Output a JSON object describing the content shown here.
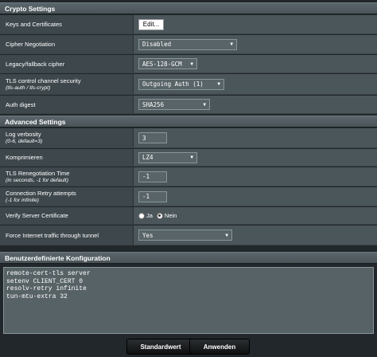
{
  "crypto": {
    "header": "Crypto Settings",
    "keys_label": "Keys and Certificates",
    "edit_label": "Edit...",
    "cipher_neg_label": "Cipher Negotiation",
    "cipher_neg_value": "Disabled",
    "legacy_label": "Legacy/fallback cipher",
    "legacy_value": "AES-128-GCM",
    "tls_label": "TLS control channel security",
    "tls_sub": "(tls-auth / tls-crypt)",
    "tls_value": "Outgoing Auth (1)",
    "digest_label": "Auth digest",
    "digest_value": "SHA256"
  },
  "advanced": {
    "header": "Advanced Settings",
    "log_label": "Log verbosity",
    "log_sub": "(0-6, default=3)",
    "log_value": "3",
    "comp_label": "Komprimieren",
    "comp_value": "LZ4",
    "reneg_label": "TLS Renegotiation Time",
    "reneg_sub": "(in seconds, -1 for default)",
    "reneg_value": "-1",
    "retry_label": "Connection Retry attempts",
    "retry_sub": "(-1 for infinite)",
    "retry_value": "-1",
    "verify_label": "Verify Server Certificate",
    "verify_yes": "Ja",
    "verify_no": "Nein",
    "force_label": "Force Internet traffic through tunnel",
    "force_value": "Yes"
  },
  "custom": {
    "header": "Benutzerdefinierte Konfiguration",
    "text": "remote-cert-tls server\nsetenv CLIENT_CERT 0\nresolv-retry infinite\ntun-mtu-extra 32"
  },
  "footer": {
    "default_label": "Standardwert",
    "apply_label": "Anwenden"
  }
}
